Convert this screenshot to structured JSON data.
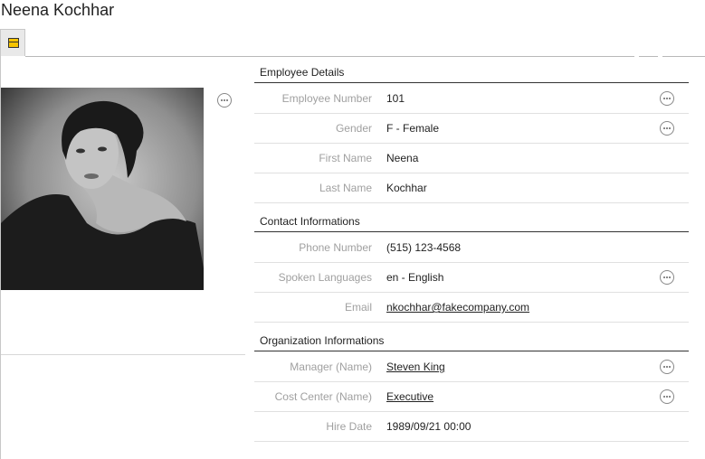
{
  "header": {
    "title": "Neena Kochhar"
  },
  "tabs": [
    {
      "icon": "form-icon"
    }
  ],
  "photo": {
    "alt": "Employee photo"
  },
  "sections": {
    "employee_details": {
      "title": "Employee Details",
      "rows": [
        {
          "label": "Employee Number",
          "value": "101"
        },
        {
          "label": "Gender",
          "value": "F - Female"
        },
        {
          "label": "First Name",
          "value": "Neena"
        },
        {
          "label": "Last Name",
          "value": "Kochhar"
        }
      ]
    },
    "contact": {
      "title": "Contact Informations",
      "rows": [
        {
          "label": "Phone Number",
          "value": "(515) 123-4568"
        },
        {
          "label": "Spoken Languages",
          "value": "en - English"
        },
        {
          "label": "Email",
          "value": "nkochhar@fakecompany.com"
        }
      ]
    },
    "organization": {
      "title": "Organization Informations",
      "rows": [
        {
          "label": "Manager (Name)",
          "value": "Steven King"
        },
        {
          "label": "Cost Center (Name)",
          "value": "Executive"
        },
        {
          "label": "Hire Date",
          "value": "1989/09/21 00:00"
        }
      ]
    }
  }
}
